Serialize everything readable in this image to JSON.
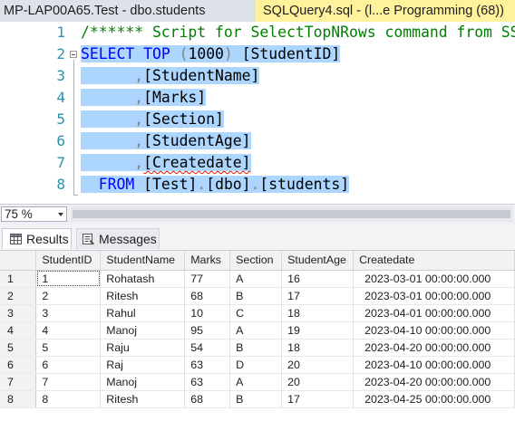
{
  "tabs": [
    {
      "label": "MP-LAP00A65.Test - dbo.students"
    },
    {
      "label": "SQLQuery4.sql - (l...e Programming (68))"
    }
  ],
  "editor": {
    "line_numbers": [
      "1",
      "2",
      "3",
      "4",
      "5",
      "6",
      "7",
      "8"
    ],
    "comment": "/****** Script for SelectTopNRows command from SSMS  ******/",
    "kw_select": "SELECT",
    "kw_top": "TOP",
    "top_open": " (",
    "top_value": "1000",
    "top_close": ")",
    "col_studentid": "[StudentID]",
    "comma": ",",
    "col_studentname": "[StudentName]",
    "col_marks": "[Marks]",
    "col_section": "[Section]",
    "col_studentage": "[StudentAge]",
    "col_createdate": "[Createdate]",
    "kw_from": "FROM",
    "tbl_db": "[Test]",
    "dot": ".",
    "tbl_schema": "[dbo]",
    "tbl_name": "[students]"
  },
  "zoom": {
    "value": "75 %"
  },
  "results_tabs": {
    "results": "Results",
    "messages": "Messages"
  },
  "grid": {
    "columns": [
      "StudentID",
      "StudentName",
      "Marks",
      "Section",
      "StudentAge",
      "Createdate"
    ],
    "rows": [
      {
        "num": "1",
        "cells": [
          "1",
          "Rohatash",
          "77",
          "A",
          "16",
          "2023-03-01 00:00:00.000"
        ]
      },
      {
        "num": "2",
        "cells": [
          "2",
          "Ritesh",
          "68",
          "B",
          "17",
          "2023-03-01 00:00:00.000"
        ]
      },
      {
        "num": "3",
        "cells": [
          "3",
          "Rahul",
          "10",
          "C",
          "18",
          "2023-04-01 00:00:00.000"
        ]
      },
      {
        "num": "4",
        "cells": [
          "4",
          "Manoj",
          "95",
          "A",
          "19",
          "2023-04-10 00:00:00.000"
        ]
      },
      {
        "num": "5",
        "cells": [
          "5",
          "Raju",
          "54",
          "B",
          "18",
          "2023-04-20 00:00:00.000"
        ]
      },
      {
        "num": "6",
        "cells": [
          "6",
          "Raj",
          "63",
          "D",
          "20",
          "2023-04-10 00:00:00.000"
        ]
      },
      {
        "num": "7",
        "cells": [
          "7",
          "Manoj",
          "63",
          "A",
          "20",
          "2023-04-20 00:00:00.000"
        ]
      },
      {
        "num": "8",
        "cells": [
          "8",
          "Ritesh",
          "68",
          "B",
          "17",
          "2023-04-25 00:00:00.000"
        ]
      }
    ]
  },
  "colors": {
    "keyword": "#0000ff",
    "comment": "#008000",
    "line_number": "#2b91af",
    "selection": "#add6ff",
    "active_tab": "#fff29d"
  }
}
